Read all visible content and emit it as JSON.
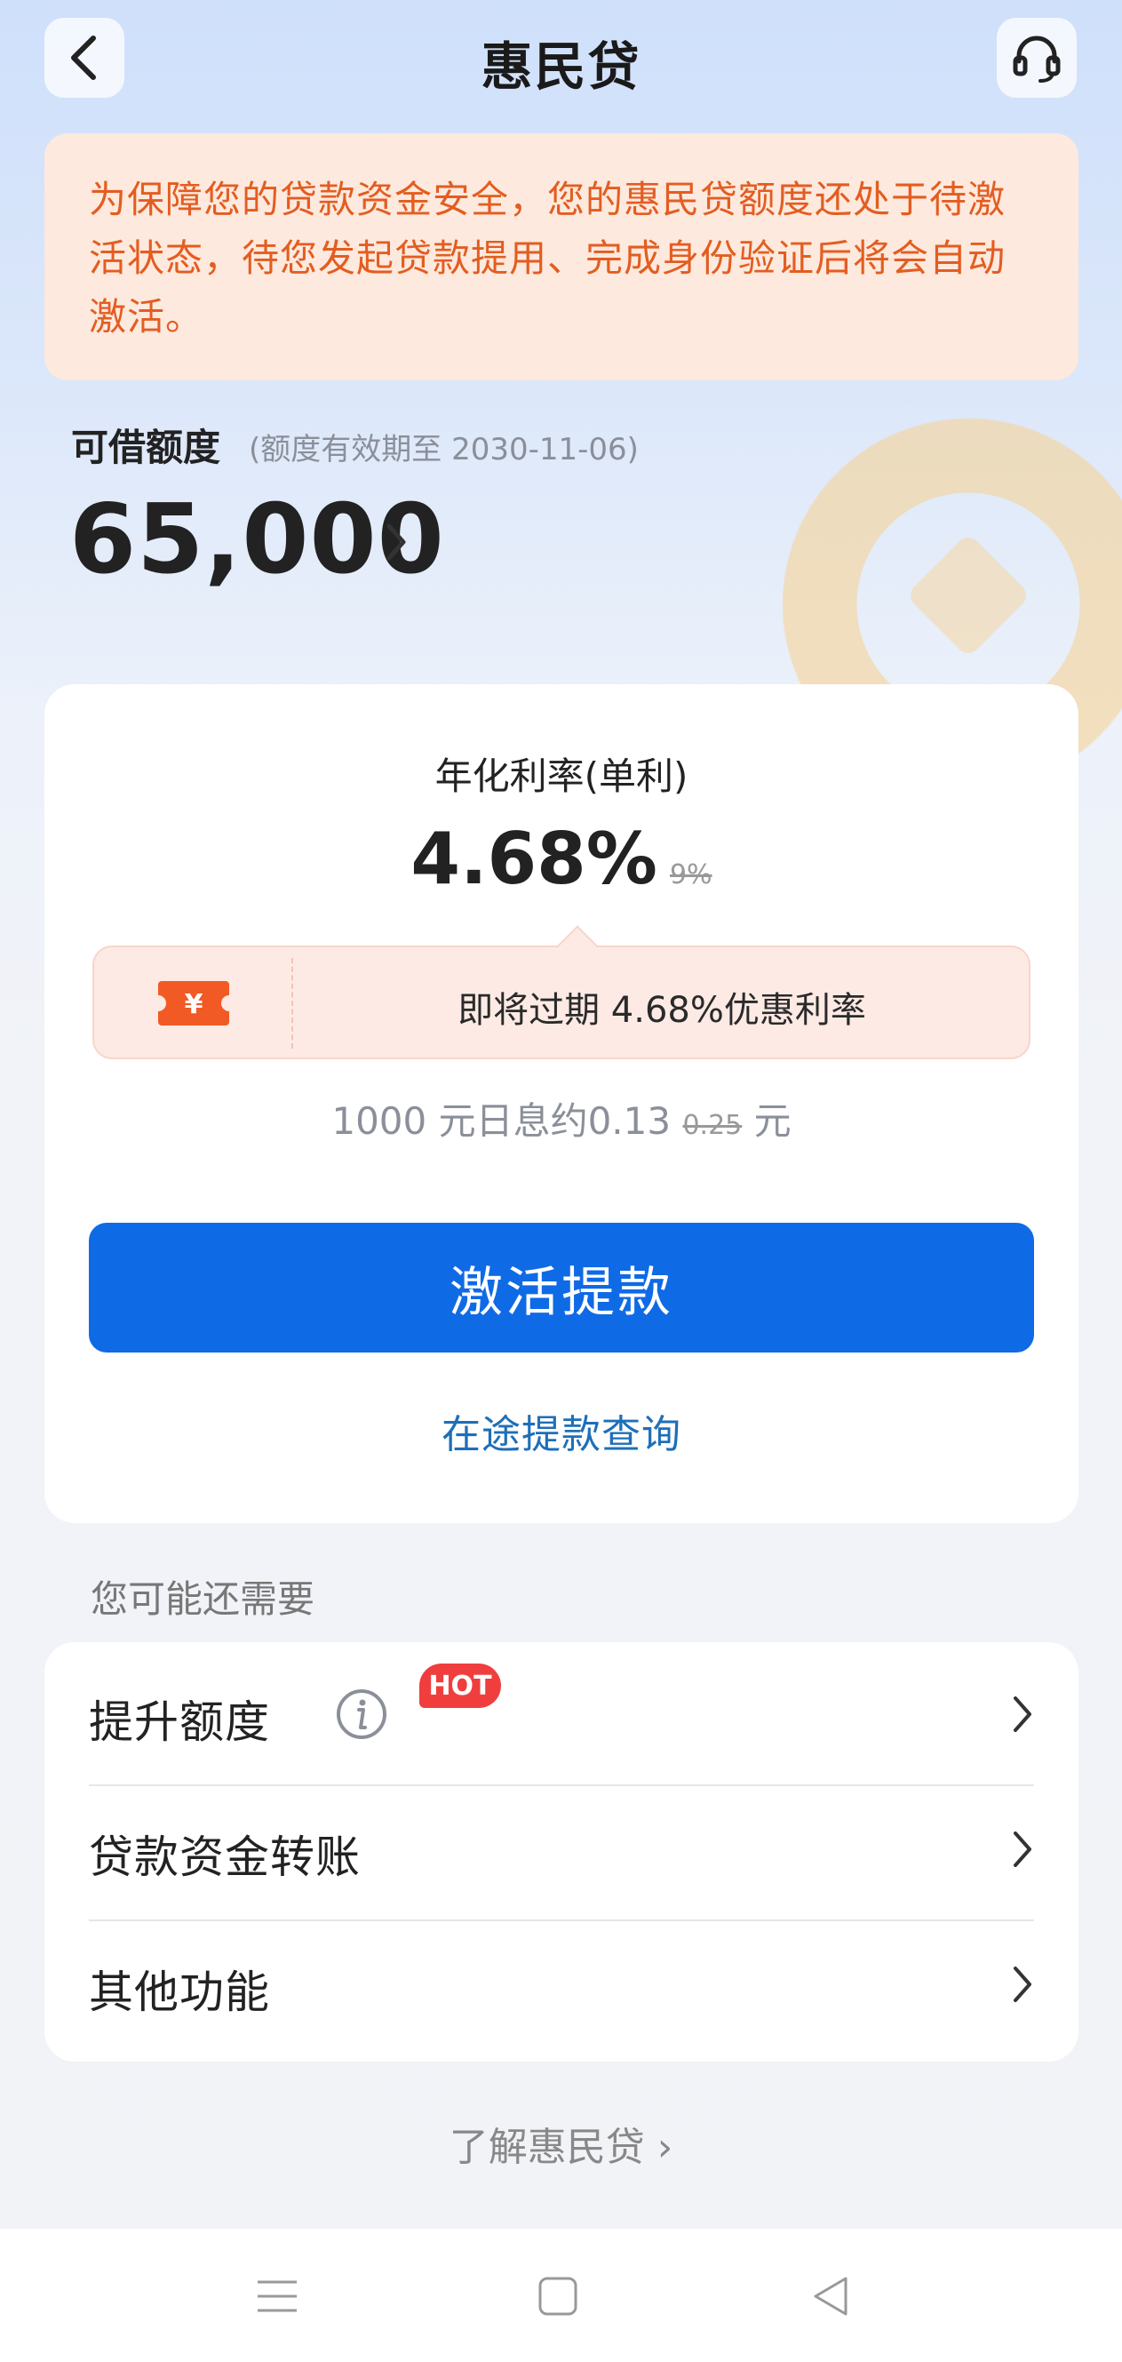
{
  "header": {
    "title": "惠民贷",
    "back_icon": "chevron-left-icon",
    "support_icon": "headset-icon"
  },
  "notice": {
    "text": "为保障您的贷款资金安全，您的惠民贷额度还处于待激活状态，待您发起贷款提用、完成身份验证后将会自动激活。"
  },
  "credit": {
    "label": "可借额度",
    "validity": "(额度有效期至 2030-11-06)",
    "amount": "65,000"
  },
  "rate": {
    "label": "年化利率(单利)",
    "value": "4.68%",
    "original": "9%",
    "promo_text": "即将过期 4.68%优惠利率",
    "promo_icon_symbol": "¥",
    "interest_prefix": "1000 元日息约0.13",
    "interest_original": "0.25",
    "interest_unit": "元",
    "activate_button": "激活提款",
    "query_link": "在途提款查询"
  },
  "more": {
    "section_title": "您可能还需要",
    "items": [
      {
        "label": "提升额度",
        "badge": "HOT"
      },
      {
        "label": "贷款资金转账"
      },
      {
        "label": "其他功能"
      }
    ]
  },
  "footer": {
    "learn_link": "了解惠民贷 ›"
  },
  "colors": {
    "accent_blue": "#0f6ae6",
    "notice_text": "#e35d21",
    "notice_bg": "#fde9dd",
    "hot_badge": "#f03e3e",
    "link_blue": "#1e6fb8"
  }
}
